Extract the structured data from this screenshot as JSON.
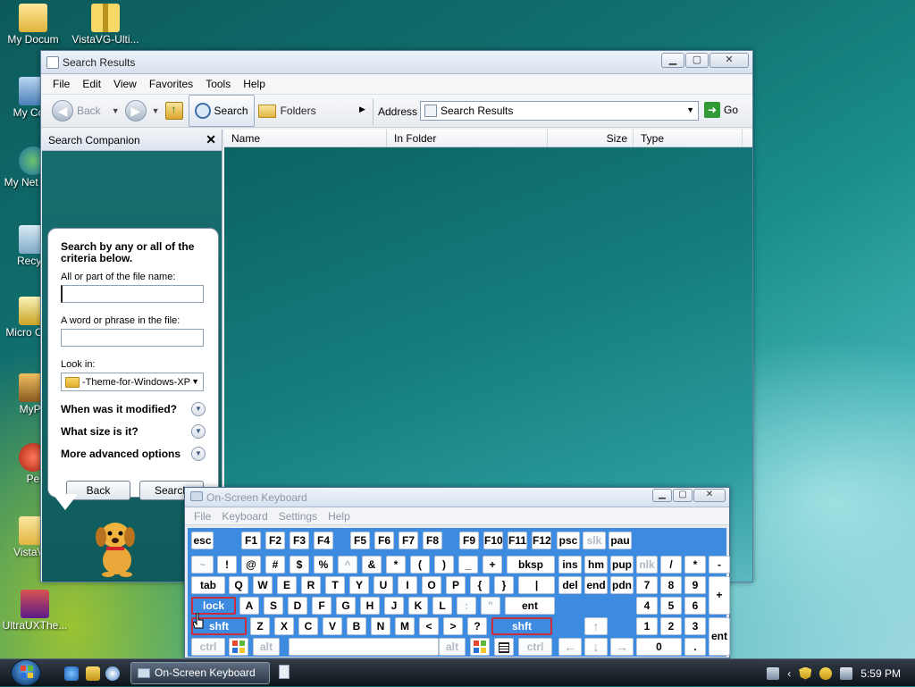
{
  "desktop": {
    "icons": [
      {
        "label": "My Docum",
        "icon": "my-documents-icon"
      },
      {
        "label": "VistaVG-Ulti...",
        "icon": "zip-folder-icon"
      },
      {
        "label": "My Com",
        "icon": "my-computer-icon"
      },
      {
        "label": "My Net Plac",
        "icon": "network-places-icon"
      },
      {
        "label": "Recycl",
        "icon": "recycle-bin-icon"
      },
      {
        "label": "Micro Outlo",
        "icon": "outlook-icon"
      },
      {
        "label": "MyPa",
        "icon": "mypal-shortcut-icon"
      },
      {
        "label": "Pe",
        "icon": "shortcut-icon"
      },
      {
        "label": "VistaVG",
        "icon": "folder-icon"
      },
      {
        "label": "UltraUXThe...",
        "icon": "ultraux-icon"
      }
    ]
  },
  "explorer": {
    "title": "Search Results",
    "menu": [
      "File",
      "Edit",
      "View",
      "Favorites",
      "Tools",
      "Help"
    ],
    "toolbar": {
      "back": "Back",
      "search": "Search",
      "folders": "Folders",
      "address_label": "Address",
      "address_value": "Search Results",
      "go": "Go"
    },
    "companion": {
      "title": "Search Companion",
      "heading": "Search by any or all of the criteria below.",
      "filename_label": "All or part of the file name:",
      "filename_value": "",
      "phrase_label": "A word or phrase in the file:",
      "phrase_value": "",
      "lookin_label": "Look in:",
      "lookin_value": "-Theme-for-Windows-XP",
      "options": [
        "When was it modified?",
        "What size is it?",
        "More advanced options"
      ],
      "back_button": "Back",
      "search_button": "Search"
    },
    "columns": [
      "Name",
      "In Folder",
      "Size",
      "Type"
    ]
  },
  "osk": {
    "title": "On-Screen Keyboard",
    "menu": [
      "File",
      "Keyboard",
      "Settings",
      "Help"
    ]
  },
  "taskbar": {
    "active_task": "On-Screen Keyboard",
    "time": "5:59 PM"
  },
  "colors": {
    "osk_key_area": "#3d8be0",
    "highlight_border": "#cc2d3b"
  }
}
